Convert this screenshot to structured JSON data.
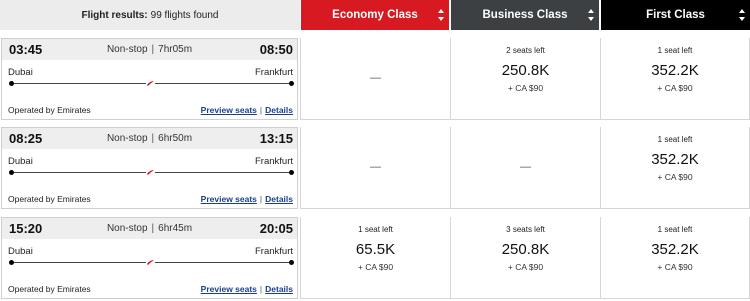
{
  "header": {
    "results_label": "Flight results:",
    "results_count": "99 flights found",
    "classes": [
      "Economy Class",
      "Business Class",
      "First Class"
    ]
  },
  "flights": [
    {
      "depart_time": "03:45",
      "stops": "Non-stop",
      "duration": "7hr05m",
      "arrive_time": "08:50",
      "from": "Dubai",
      "to": "Frankfurt",
      "operated_by": "Operated by Emirates",
      "preview_seats": "Preview seats",
      "details": "Details",
      "economy": {
        "dash": "—"
      },
      "business": {
        "seats": "2 seats left",
        "price": "250.8K",
        "tax": "+ CA $90"
      },
      "first": {
        "seats": "1 seat left",
        "price": "352.2K",
        "tax": "+ CA $90"
      }
    },
    {
      "depart_time": "08:25",
      "stops": "Non-stop",
      "duration": "6hr50m",
      "arrive_time": "13:15",
      "from": "Dubai",
      "to": "Frankfurt",
      "operated_by": "Operated by Emirates",
      "preview_seats": "Preview seats",
      "details": "Details",
      "economy": {
        "dash": "—"
      },
      "business": {
        "dash": "—"
      },
      "first": {
        "seats": "1 seat left",
        "price": "352.2K",
        "tax": "+ CA $90"
      }
    },
    {
      "depart_time": "15:20",
      "stops": "Non-stop",
      "duration": "6hr45m",
      "arrive_time": "20:05",
      "from": "Dubai",
      "to": "Frankfurt",
      "operated_by": "Operated by Emirates",
      "preview_seats": "Preview seats",
      "details": "Details",
      "economy": {
        "seats": "1 seat left",
        "price": "65.5K",
        "tax": "+ CA $90"
      },
      "business": {
        "seats": "3 seats left",
        "price": "250.8K",
        "tax": "+ CA $90"
      },
      "first": {
        "seats": "1 seat left",
        "price": "352.2K",
        "tax": "+ CA $90"
      }
    }
  ],
  "pipe_separator": "|",
  "colors": {
    "economy": "#d71921",
    "business": "#3d4043",
    "first": "#000000",
    "link": "#1a3f8f"
  },
  "icons": {
    "airline_logo": "emirates-logo-icon",
    "sort": "sort-arrows-icon"
  }
}
